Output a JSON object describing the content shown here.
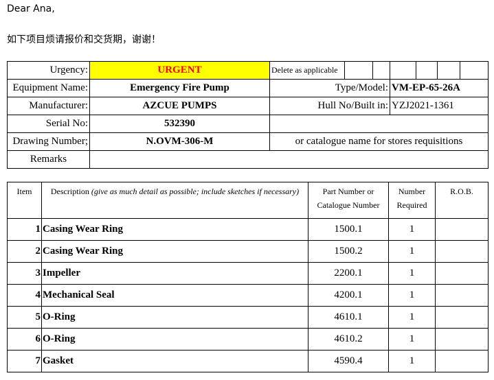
{
  "greeting": "Dear Ana,",
  "request": "如下项目烦请报价和交货期，谢谢！",
  "header": {
    "urgency_label": "Urgency:",
    "urgency_value": "URGENT",
    "delete_label": "Delete as applicable",
    "equipment_label": "Equipment Name:",
    "equipment_value": "Emergency Fire Pump",
    "type_label": "Type/Model:",
    "type_value": "VM-EP-65-26A",
    "manufacturer_label": "Manufacturer:",
    "manufacturer_value": "AZCUE PUMPS",
    "hull_label": "Hull No/Built in:",
    "hull_value": "YZJ2021-1361",
    "serial_label": "Serial No:",
    "serial_value": "532390",
    "drawing_label": "Drawing Number;",
    "drawing_value": "N.OVM-306-M",
    "catalogue_note": "or catalogue name for stores requisitions",
    "remarks_label": "Remarks"
  },
  "items_table": {
    "col_item": "Item",
    "col_desc": "Description",
    "col_desc_note": "(give as much detail as possible; include sketches if necessary)",
    "col_part": "Part Number or Catalogue Number",
    "col_number": "Number Required",
    "col_rob": "R.O.B.",
    "rows": [
      {
        "item": "1",
        "desc": "Casing Wear Ring",
        "part": "1500.1",
        "qty": "1"
      },
      {
        "item": "2",
        "desc": "Casing Wear Ring",
        "part": "1500.2",
        "qty": "1"
      },
      {
        "item": "3",
        "desc": "Impeller",
        "part": "2200.1",
        "qty": "1"
      },
      {
        "item": "4",
        "desc": "Mechanical Seal",
        "part": "4200.1",
        "qty": "1"
      },
      {
        "item": "5",
        "desc": "O-Ring",
        "part": "4610.1",
        "qty": "1"
      },
      {
        "item": "6",
        "desc": "O-Ring",
        "part": "4610.2",
        "qty": "1"
      },
      {
        "item": "7",
        "desc": "Gasket",
        "part": "4590.4",
        "qty": "1"
      }
    ]
  }
}
